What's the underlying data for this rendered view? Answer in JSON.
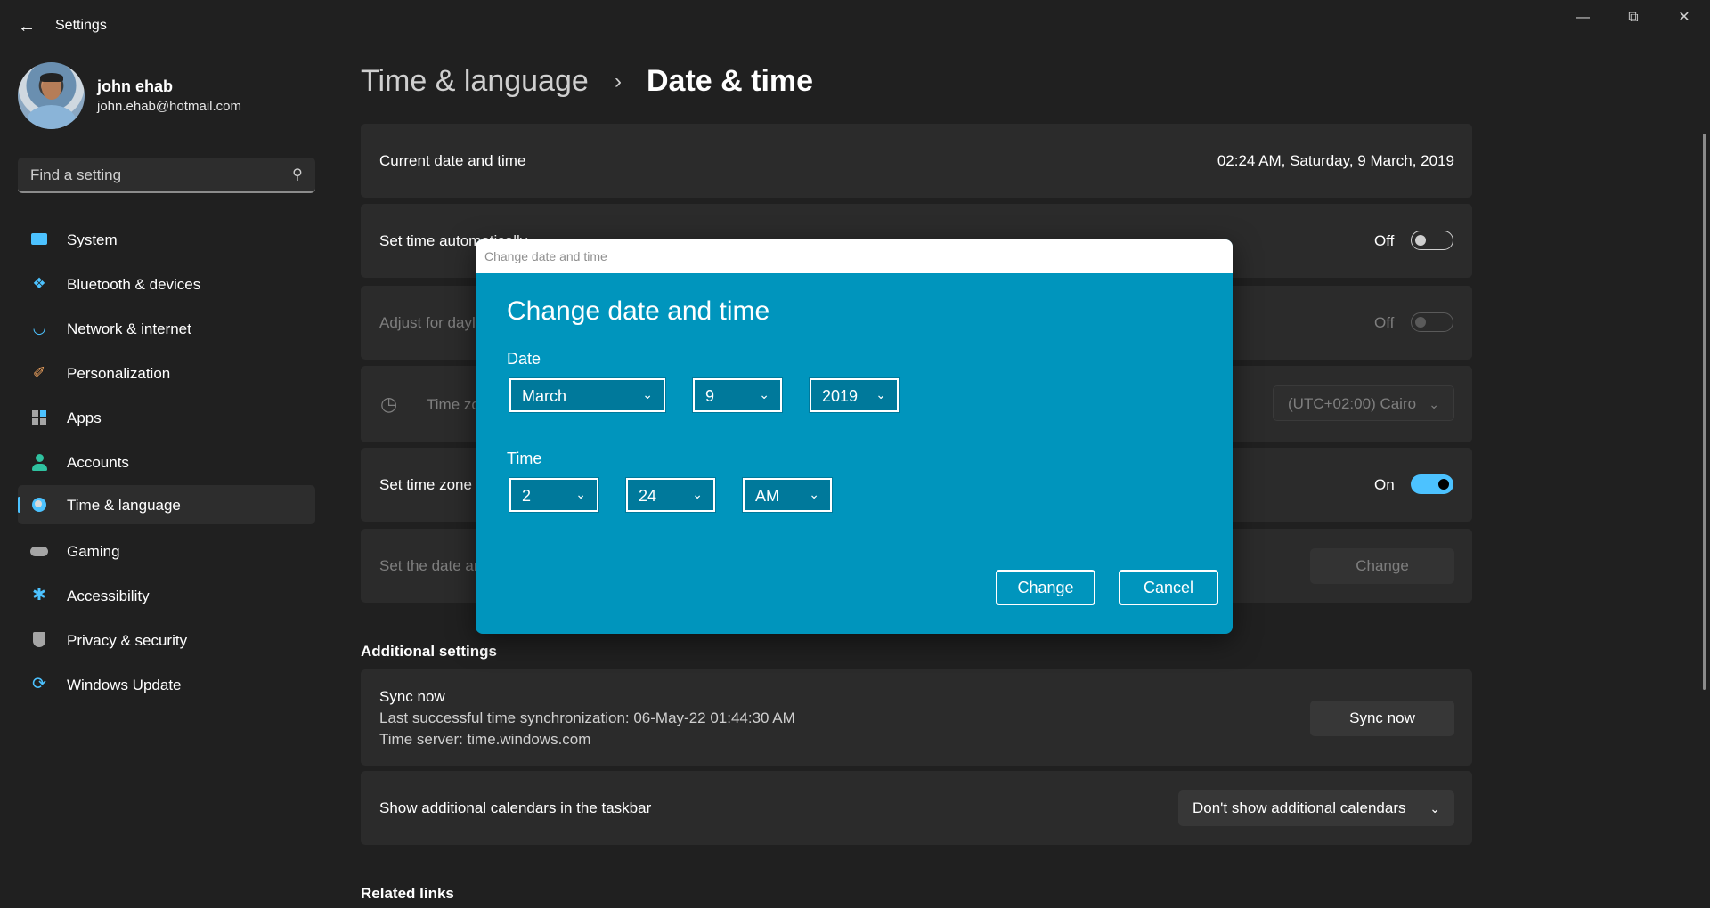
{
  "window": {
    "title": "Settings"
  },
  "user": {
    "name": "john ehab",
    "email": "john.ehab@hotmail.com"
  },
  "search": {
    "placeholder": "Find a setting"
  },
  "nav": [
    {
      "label": "System",
      "icon": "system-icon",
      "color": "#4cc2ff"
    },
    {
      "label": "Bluetooth & devices",
      "icon": "bluetooth-icon",
      "color": "#4cc2ff"
    },
    {
      "label": "Network & internet",
      "icon": "wifi-icon",
      "color": "#4cc2ff"
    },
    {
      "label": "Personalization",
      "icon": "brush-icon",
      "color": "#f0a35e"
    },
    {
      "label": "Apps",
      "icon": "apps-icon",
      "color": "#a5a5a5"
    },
    {
      "label": "Accounts",
      "icon": "person-icon",
      "color": "#2fc2a0"
    },
    {
      "label": "Time & language",
      "icon": "clock-globe-icon",
      "color": "#4cc2ff",
      "active": true
    },
    {
      "label": "Gaming",
      "icon": "gamepad-icon",
      "color": "#a5a5a5"
    },
    {
      "label": "Accessibility",
      "icon": "accessibility-icon",
      "color": "#4cc2ff"
    },
    {
      "label": "Privacy & security",
      "icon": "shield-icon",
      "color": "#a5a5a5"
    },
    {
      "label": "Windows Update",
      "icon": "update-icon",
      "color": "#4cc2ff"
    }
  ],
  "breadcrumb": {
    "parent": "Time & language",
    "current": "Date & time"
  },
  "settings": {
    "current_label": "Current date and time",
    "current_value": "02:24 AM, Saturday, 9 March, 2019",
    "auto_time_label": "Set time automatically",
    "auto_time_state": "Off",
    "dst_label": "Adjust for daylight saving time automatically",
    "dst_state": "Off",
    "timezone_label": "Time zone",
    "timezone_value": "(UTC+02:00) Cairo",
    "auto_tz_label": "Set time zone automatically",
    "auto_tz_state": "On",
    "manual_label": "Set the date and time manually",
    "manual_button": "Change"
  },
  "additional": {
    "title": "Additional settings",
    "sync_title": "Sync now",
    "sync_last": "Last successful time synchronization: 06-May-22 01:44:30 AM",
    "sync_server": "Time server: time.windows.com",
    "sync_button": "Sync now",
    "calendars_label": "Show additional calendars in the taskbar",
    "calendars_value": "Don't show additional calendars"
  },
  "related": {
    "title": "Related links"
  },
  "dialog": {
    "window_title": "Change date and time",
    "heading": "Change date and time",
    "date_label": "Date",
    "month": "March",
    "day": "9",
    "year": "2019",
    "time_label": "Time",
    "hour": "2",
    "minute": "24",
    "ampm": "AM",
    "change_button": "Change",
    "cancel_button": "Cancel"
  }
}
